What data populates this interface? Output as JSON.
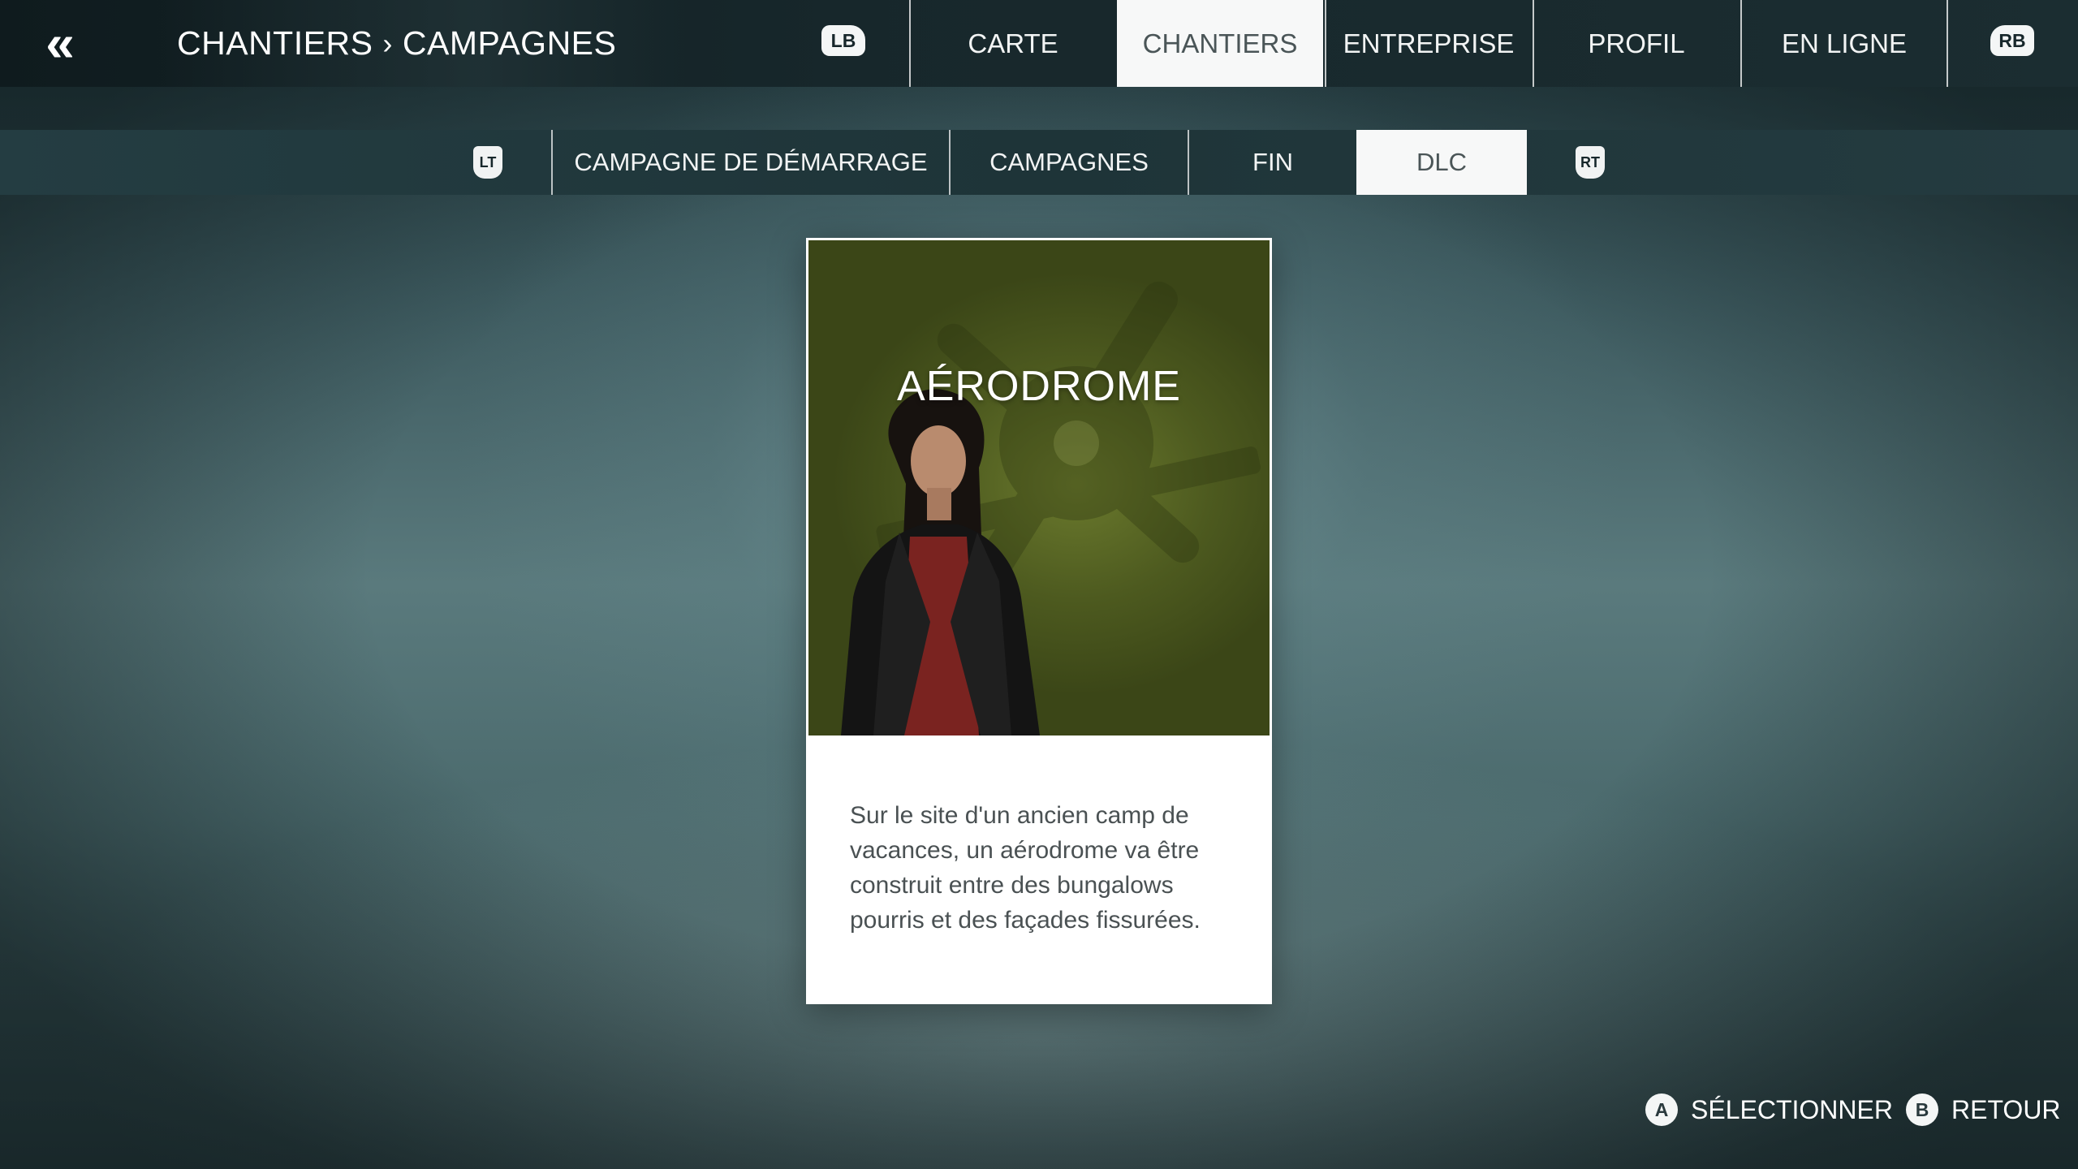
{
  "header": {
    "breadcrumb": {
      "parent": "CHANTIERS",
      "current": "CAMPAGNES"
    },
    "bumper_left": "LB",
    "bumper_right": "RB",
    "tabs": [
      {
        "label": "CARTE",
        "active": false
      },
      {
        "label": "CHANTIERS",
        "active": true
      },
      {
        "label": "ENTREPRISE",
        "active": false
      },
      {
        "label": "PROFIL",
        "active": false
      },
      {
        "label": "EN LIGNE",
        "active": false
      }
    ]
  },
  "subnav": {
    "trigger_left": "LT",
    "trigger_right": "RT",
    "tabs": [
      {
        "label": "CAMPAGNE DE DÉMARRAGE",
        "active": false
      },
      {
        "label": "CAMPAGNES",
        "active": false
      },
      {
        "label": "FIN",
        "active": false
      },
      {
        "label": "DLC",
        "active": true
      }
    ]
  },
  "card": {
    "title": "AÉRODROME",
    "description": "Sur le site d'un ancien camp de vacances, un aérodrome va être construit entre des bungalows pourris et des façades fissurées."
  },
  "footer": {
    "select": {
      "button": "A",
      "label": "SÉLECTIONNER"
    },
    "back": {
      "button": "B",
      "label": "RETOUR"
    }
  },
  "colors": {
    "active_tab_bg": "#f7f8f8",
    "card_image_tint": "#5a6a24",
    "topbar_bg": "#17272b"
  }
}
